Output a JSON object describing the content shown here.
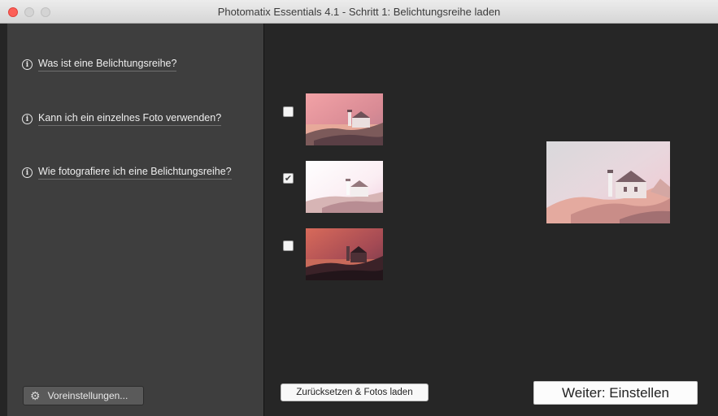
{
  "window": {
    "title": "Photomatix Essentials 4.1  -  Schritt 1: Belichtungsreihe laden"
  },
  "sidebar": {
    "help_items": [
      {
        "label": "Was ist eine Belichtungsreihe?",
        "icon": "info-icon"
      },
      {
        "label": "Kann ich ein einzelnes Foto verwenden?",
        "icon": "info-icon"
      },
      {
        "label": "Wie fotografiere ich eine Belichtungsreihe?",
        "icon": "info-icon"
      }
    ],
    "preferences_label": "Voreinstellungen...",
    "preferences_icon": "gear-icon"
  },
  "main": {
    "exposures": [
      {
        "checked": false,
        "exposure": "normal"
      },
      {
        "checked": true,
        "exposure": "bright"
      },
      {
        "checked": false,
        "exposure": "dark"
      }
    ],
    "checkmark": "✔",
    "reset_label": "Zurücksetzen & Fotos laden",
    "next_label": "Weiter: Einstellen"
  },
  "colors": {
    "sidebar_bg": "#3e3e3e",
    "main_bg": "#262626",
    "close_button": "#fc5f57"
  }
}
